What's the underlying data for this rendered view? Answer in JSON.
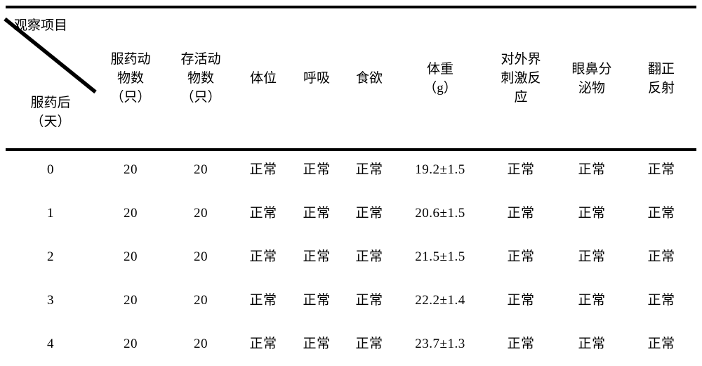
{
  "table": {
    "corner": {
      "top_label": "观察项目",
      "bottom_label_line1": "服药后",
      "bottom_label_line2": "（天）",
      "diagonal_icon": "diagonal-divider-icon"
    },
    "columns": [
      {
        "id": "day",
        "lines": [
          "服药后",
          "（天）"
        ]
      },
      {
        "id": "dosed",
        "lines": [
          "服药动",
          "物数",
          "（只）"
        ]
      },
      {
        "id": "alive",
        "lines": [
          "存活动",
          "物数",
          "（只）"
        ]
      },
      {
        "id": "posture",
        "lines": [
          "体位"
        ]
      },
      {
        "id": "resp",
        "lines": [
          "呼吸"
        ]
      },
      {
        "id": "appetite",
        "lines": [
          "食欲"
        ]
      },
      {
        "id": "weight",
        "lines": [
          "体重",
          "（g）"
        ]
      },
      {
        "id": "stimulus",
        "lines": [
          "对外界",
          "刺激反",
          "应"
        ]
      },
      {
        "id": "secretion",
        "lines": [
          "眼鼻分",
          "泌物"
        ]
      },
      {
        "id": "reflex",
        "lines": [
          "翻正",
          "反射"
        ]
      }
    ],
    "header": {
      "dosed_l1": "服药动",
      "dosed_l2": "物数",
      "dosed_l3": "（只）",
      "alive_l1": "存活动",
      "alive_l2": "物数",
      "alive_l3": "（只）",
      "posture": "体位",
      "resp": "呼吸",
      "appetite": "食欲",
      "weight_l1": "体重",
      "weight_l2": "（g）",
      "stimulus_l1": "对外界",
      "stimulus_l2": "刺激反",
      "stimulus_l3": "应",
      "secretion_l1": "眼鼻分",
      "secretion_l2": "泌物",
      "reflex_l1": "翻正",
      "reflex_l2": "反射"
    },
    "rows": [
      {
        "day": "0",
        "dosed": "20",
        "alive": "20",
        "posture": "正常",
        "resp": "正常",
        "appetite": "正常",
        "weight": "19.2±1.5",
        "stimulus": "正常",
        "secretion": "正常",
        "reflex": "正常"
      },
      {
        "day": "1",
        "dosed": "20",
        "alive": "20",
        "posture": "正常",
        "resp": "正常",
        "appetite": "正常",
        "weight": "20.6±1.5",
        "stimulus": "正常",
        "secretion": "正常",
        "reflex": "正常"
      },
      {
        "day": "2",
        "dosed": "20",
        "alive": "20",
        "posture": "正常",
        "resp": "正常",
        "appetite": "正常",
        "weight": "21.5±1.5",
        "stimulus": "正常",
        "secretion": "正常",
        "reflex": "正常"
      },
      {
        "day": "3",
        "dosed": "20",
        "alive": "20",
        "posture": "正常",
        "resp": "正常",
        "appetite": "正常",
        "weight": "22.2±1.4",
        "stimulus": "正常",
        "secretion": "正常",
        "reflex": "正常"
      },
      {
        "day": "4",
        "dosed": "20",
        "alive": "20",
        "posture": "正常",
        "resp": "正常",
        "appetite": "正常",
        "weight": "23.7±1.3",
        "stimulus": "正常",
        "secretion": "正常",
        "reflex": "正常"
      }
    ]
  },
  "style": {
    "rule_color": "#000000",
    "text_color": "#000000",
    "background": "#ffffff"
  }
}
